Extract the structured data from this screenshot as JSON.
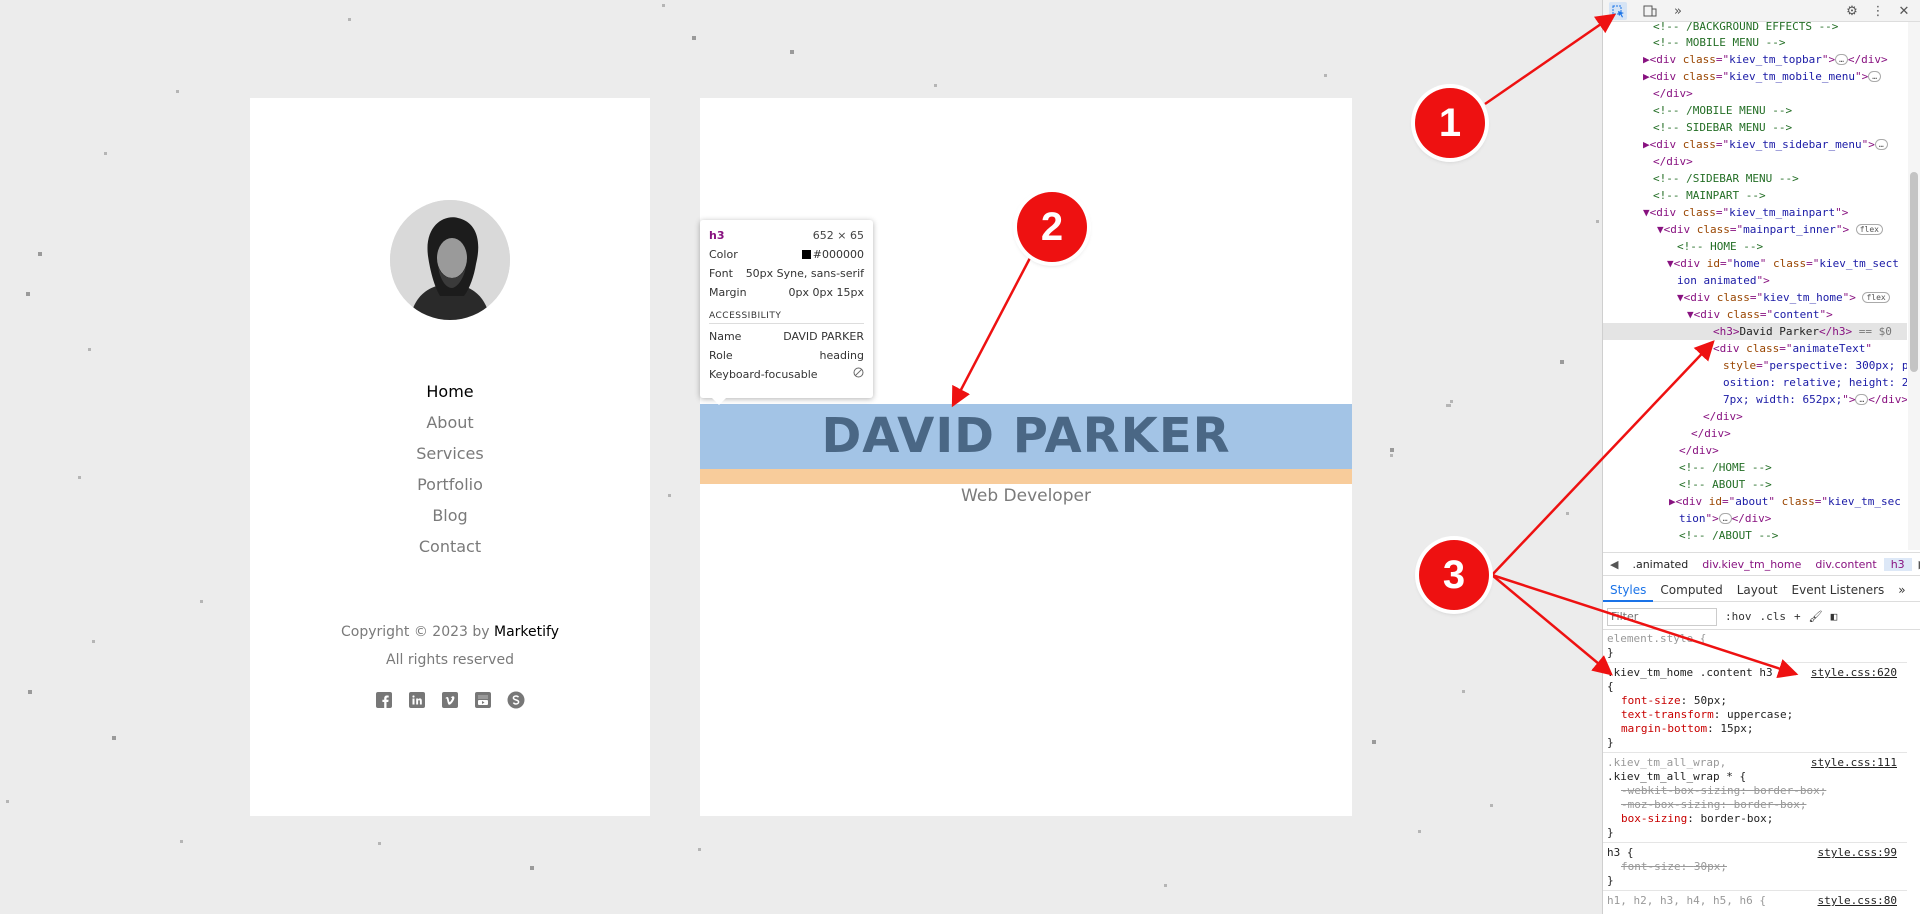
{
  "sidebar": {
    "nav": [
      {
        "label": "Home",
        "active": true
      },
      {
        "label": "About",
        "active": false
      },
      {
        "label": "Services",
        "active": false
      },
      {
        "label": "Portfolio",
        "active": false
      },
      {
        "label": "Blog",
        "active": false
      },
      {
        "label": "Contact",
        "active": false
      }
    ],
    "copyright_prefix": "Copyright © 2023 by",
    "copyright_brand": "Marketify",
    "rights": "All rights reserved",
    "socials": [
      "facebook-icon",
      "linkedin-icon",
      "vimeo-icon",
      "youtube-icon",
      "skype-icon"
    ]
  },
  "main": {
    "name": "DAVID PARKER",
    "role": "Web Developer"
  },
  "tooltip": {
    "tag": "h3",
    "size": "652 × 65",
    "color_label": "Color",
    "color_value": "#000000",
    "font_label": "Font",
    "font_value": "50px Syne, sans-serif",
    "margin_label": "Margin",
    "margin_value": "0px 0px 15px",
    "accessibility_heading": "ACCESSIBILITY",
    "name_label": "Name",
    "name_value": "DAVID PARKER",
    "role_label": "Role",
    "role_value": "heading",
    "keyboard_label": "Keyboard-focusable"
  },
  "devtools": {
    "toolbar_icons": [
      "inspect-icon",
      "device-toggle-icon",
      "more-tabs-icon",
      "settings-icon",
      "kebab-menu-icon",
      "close-icon"
    ],
    "breadcrumbs": [
      ".animated",
      "div.kiev_tm_home",
      "div.content",
      "h3"
    ],
    "styles_tabs": [
      "Styles",
      "Computed",
      "Layout",
      "Event Listeners"
    ],
    "filter_placeholder": "Filter",
    "hov": ":hov",
    "cls": ".cls",
    "selected_suffix": "== $0",
    "elements": {
      "c1": "<!-- /BACKGROUND EFFECTS -->",
      "c2": "<!-- MOBILE MENU -->",
      "topbar": "kiev_tm_topbar",
      "mobile_menu": "kiev_tm_mobile_menu",
      "c3": "<!-- /MOBILE MENU -->",
      "c4": "<!-- SIDEBAR MENU -->",
      "sidebar_menu": "kiev_tm_sidebar_menu",
      "c5": "<!-- /SIDEBAR MENU -->",
      "c6": "<!-- MAINPART -->",
      "mainpart": "kiev_tm_mainpart",
      "mainpart_inner": "mainpart_inner",
      "c7": "<!-- HOME -->",
      "home_id": "home",
      "home_class_a": "kiev_tm_sect",
      "home_class_b": "ion animated",
      "kiev_home": "kiev_tm_home",
      "content": "content",
      "h3_text": "David Parker",
      "animate_class": "animateText",
      "style_a": "perspective: 300px; p",
      "style_b": "osition: relative; height: 2",
      "style_c": "7px; width: 652px;",
      "c8": "<!-- /HOME -->",
      "c9": "<!-- ABOUT -->",
      "about_id": "about",
      "about_class_a": "kiev_tm_sec",
      "about_class_b": "tion",
      "c10": "<!-- /ABOUT -->",
      "flex": "flex"
    },
    "rules": {
      "element_style": "element.style {",
      "r1_selector": ".kiev_tm_home .content h3",
      "r1_source": "style.css:620",
      "r1_props": [
        [
          "font-size",
          "50px;"
        ],
        [
          "text-transform",
          "uppercase;"
        ],
        [
          "margin-bottom",
          "15px;"
        ]
      ],
      "r2_sel_a": ".kiev_tm_all_wrap,",
      "r2_sel_b": ".kiev_tm_all_wrap * {",
      "r2_source": "style.css:111",
      "r2_props": [
        [
          "-webkit-box-sizing",
          "border-box;"
        ],
        [
          "-moz-box-sizing",
          "border-box;"
        ],
        [
          "box-sizing",
          "border-box;"
        ]
      ],
      "r3_selector": "h3 {",
      "r3_source": "style.css:99",
      "r3_prop": [
        "font-size",
        "30px;"
      ],
      "r4_selector": "h1, h2, h3, h4, h5, h6 {",
      "r4_source": "style.css:80"
    }
  },
  "annotations": [
    "1",
    "2",
    "3"
  ],
  "colors": {
    "accent_red": "#ee1111",
    "highlight_blue": "#a3c4e6",
    "highlight_margin": "#f8cc9b"
  }
}
